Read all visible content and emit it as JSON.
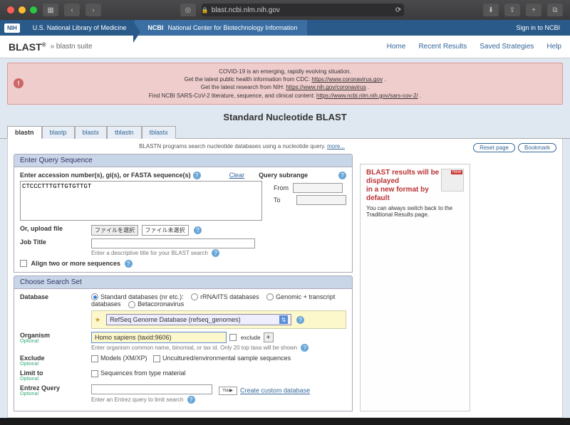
{
  "chrome": {
    "url": "blast.ncbi.nlm.nih.gov"
  },
  "nih_bar": {
    "nih": "NIH",
    "nlm": "U.S. National Library of Medicine",
    "ncbi_label": "NCBI",
    "ncbi_full": "National Center for Biotechnology Information",
    "signin": "Sign in to NCBI"
  },
  "header": {
    "logo": "BLAST",
    "suffix": "» blastn suite",
    "nav": [
      "Home",
      "Recent Results",
      "Saved Strategies",
      "Help"
    ]
  },
  "covid": {
    "l1": "COVID-19 is an emerging, rapidly evolving situation.",
    "l2a": "Get the latest public health information from CDC: ",
    "l2b": "https://www.coronavirus.gov",
    "l3a": "Get the latest research from NIH: ",
    "l3b": "https://www.nih.gov/coronavirus",
    "l4a": "Find NCBI SARS-CoV-2 literature, sequence, and clinical content: ",
    "l4b": "https://www.ncbi.nlm.nih.gov/sars-cov-2/"
  },
  "page_title": "Standard Nucleotide BLAST",
  "tabs": [
    "blastn",
    "blastp",
    "blastx",
    "tblastn",
    "tblastx"
  ],
  "desc": {
    "text": "BLASTN programs search nucleotide databases using a nucleotide query. ",
    "more": "more..."
  },
  "buttons": {
    "reset": "Reset page",
    "bookmark": "Bookmark"
  },
  "query_section": {
    "header": "Enter Query Sequence",
    "accession_label": "Enter accession number(s), gi(s), or FASTA sequence(s)",
    "clear": "Clear",
    "sequence_value": "CTCCCTTTGTTGTGTTGT",
    "subrange_label": "Query subrange",
    "from": "From",
    "to": "To",
    "upload_label": "Or, upload file",
    "file_choose": "ファイルを選択",
    "file_none": "ファイル未選択",
    "job_title": "Job Title",
    "job_hint": "Enter a descriptive title for your BLAST search",
    "align_two": "Align two or more sequences"
  },
  "search_set": {
    "header": "Choose Search Set",
    "database_label": "Database",
    "db_options": [
      "Standard databases (nr etc.):",
      "rRNA/ITS databases",
      "Genomic + transcript databases",
      "Betacoronavirus"
    ],
    "db_selected": "RefSeq Genome Database (refseq_genomes)",
    "organism_label": "Organism",
    "optional": "Optional",
    "organism_value": "Homo sapiens (taxid:9606)",
    "exclude_word": "exclude",
    "organism_hint": "Enter organism common name, binomial, or tax id. Only 20 top taxa will be shown",
    "exclude_label": "Exclude",
    "exclude_models": "Models (XM/XP)",
    "exclude_uncultured": "Uncultured/environmental sample sequences",
    "limit_label": "Limit to",
    "limit_seq": "Sequences from type material",
    "entrez_label": "Entrez Query",
    "entrez_hint": "Enter an Entrez query to limit search",
    "create_custom": "Create custom database",
    "youtube": "YouTube"
  },
  "sidebar": {
    "title1": "BLAST results will be displayed",
    "title2": "in a new format by default",
    "body": "You can always switch back to the Traditional Results page."
  }
}
